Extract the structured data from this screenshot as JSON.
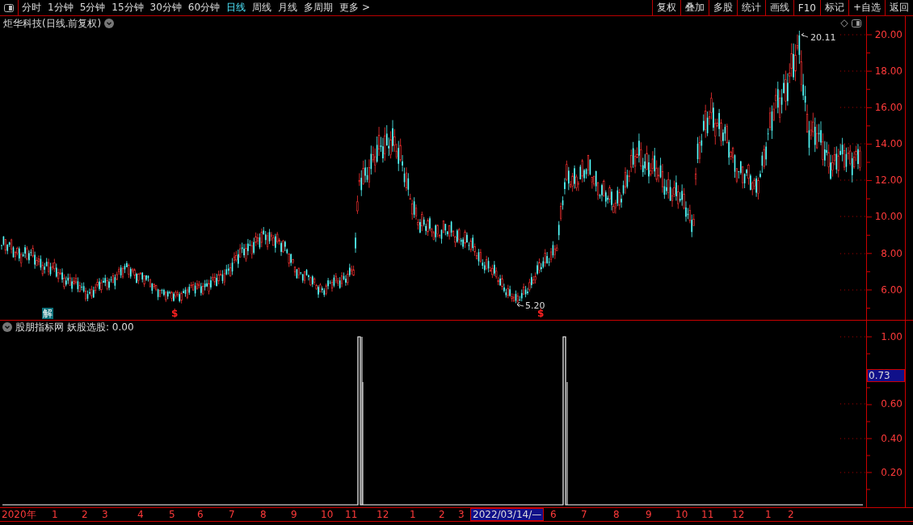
{
  "toolbar": {
    "periods": [
      {
        "label": "分时",
        "selected": false
      },
      {
        "label": "1分钟",
        "selected": false
      },
      {
        "label": "5分钟",
        "selected": false
      },
      {
        "label": "15分钟",
        "selected": false
      },
      {
        "label": "30分钟",
        "selected": false
      },
      {
        "label": "60分钟",
        "selected": false
      },
      {
        "label": "日线",
        "selected": true
      },
      {
        "label": "周线",
        "selected": false
      },
      {
        "label": "月线",
        "selected": false
      },
      {
        "label": "多周期",
        "selected": false
      },
      {
        "label": "更多 >",
        "selected": false
      }
    ],
    "actions": [
      "复权",
      "叠加",
      "多股",
      "统计",
      "画线",
      "F10",
      "标记",
      "+自选",
      "返回"
    ]
  },
  "main_chart": {
    "title": "炬华科技(日线.前复权)",
    "high_label": "20.11",
    "low_label": "5.20",
    "y_ticks": [
      "20.00",
      "18.00",
      "16.00",
      "14.00",
      "12.00",
      "10.00",
      "8.00",
      "6.00"
    ],
    "markers": [
      {
        "kind": "solution",
        "text": "解"
      },
      {
        "kind": "dollar",
        "text": "$"
      },
      {
        "kind": "dollar",
        "text": "$"
      }
    ]
  },
  "indicator": {
    "title": "股朋指标网",
    "reading": "妖股选股: 0.00",
    "y_ticks": [
      "1.00",
      "0.60",
      "0.40",
      "0.20"
    ],
    "cursor_value": "0.73"
  },
  "time_axis": {
    "labels": [
      {
        "kind": "year",
        "text": "2020年"
      },
      {
        "kind": "month",
        "text": "1"
      },
      {
        "kind": "month",
        "text": "2"
      },
      {
        "kind": "month",
        "text": "3"
      },
      {
        "kind": "month",
        "text": "4"
      },
      {
        "kind": "month",
        "text": "5"
      },
      {
        "kind": "month",
        "text": "6"
      },
      {
        "kind": "month",
        "text": "7"
      },
      {
        "kind": "month",
        "text": "8"
      },
      {
        "kind": "month",
        "text": "9"
      },
      {
        "kind": "month",
        "text": "10"
      },
      {
        "kind": "month",
        "text": "11"
      },
      {
        "kind": "month",
        "text": "12"
      },
      {
        "kind": "month",
        "text": "1"
      },
      {
        "kind": "month",
        "text": "2"
      },
      {
        "kind": "month",
        "text": "3"
      },
      {
        "kind": "cursor",
        "text": "2022/03/14/—"
      },
      {
        "kind": "month",
        "text": "6"
      },
      {
        "kind": "month",
        "text": "7"
      },
      {
        "kind": "month",
        "text": "8"
      },
      {
        "kind": "month",
        "text": "9"
      },
      {
        "kind": "month",
        "text": "10"
      },
      {
        "kind": "month",
        "text": "11"
      },
      {
        "kind": "month",
        "text": "12"
      },
      {
        "kind": "month",
        "text": "1"
      },
      {
        "kind": "month",
        "text": "2"
      }
    ]
  }
}
